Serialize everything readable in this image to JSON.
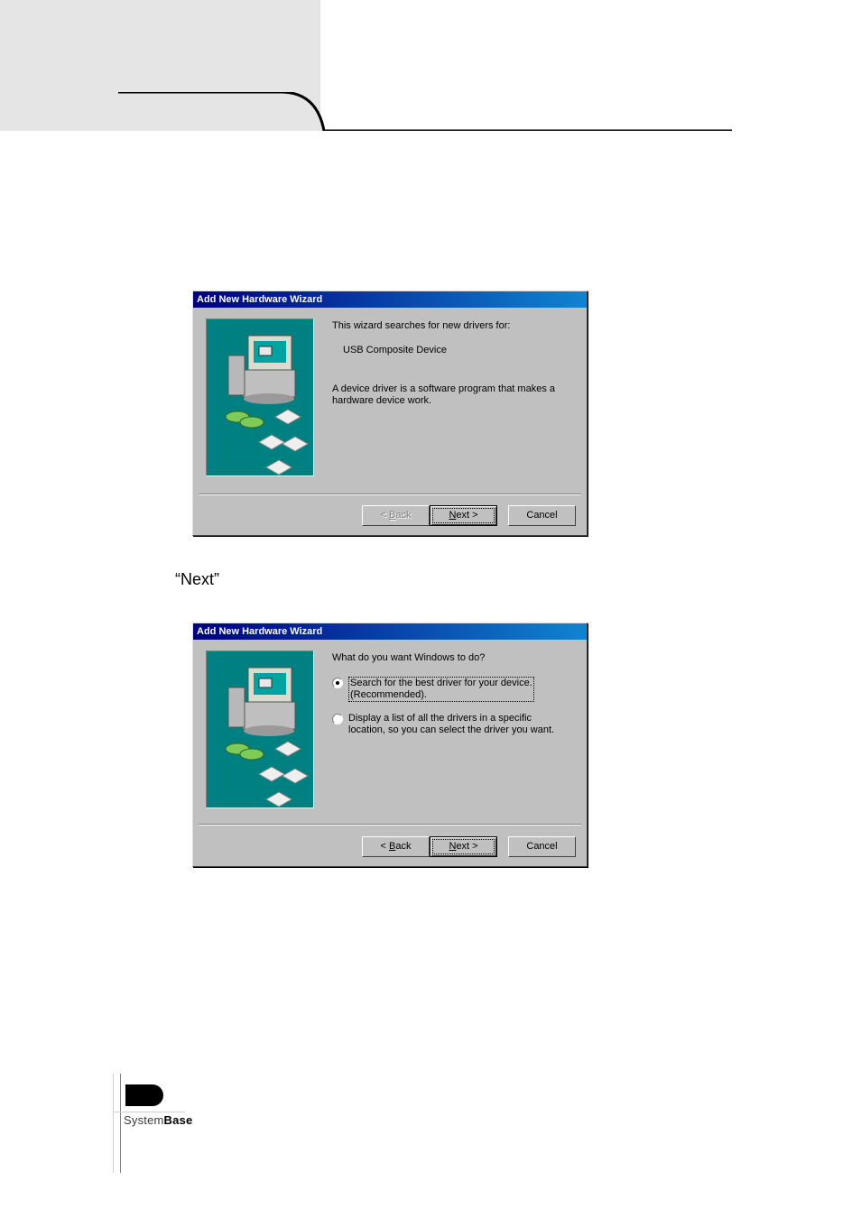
{
  "header": {},
  "caption": {
    "text": "“Next”"
  },
  "dialog1": {
    "title": "Add New Hardware Wizard",
    "line1": "This wizard searches for new drivers for:",
    "device": "USB Composite Device",
    "desc": "A device driver is a software program that makes a hardware device work.",
    "buttons": {
      "back_prefix": "< ",
      "back_ul": "B",
      "back_suffix": "ack",
      "next_prefix": "",
      "next_ul": "N",
      "next_suffix": "ext >",
      "cancel": "Cancel"
    }
  },
  "dialog2": {
    "title": "Add New Hardware Wizard",
    "question": "What do you want Windows to do?",
    "opt1_line1": "Search for the best driver for your device.",
    "opt1_line2": "(Recommended).",
    "opt2_line1": "Display a list of all the drivers in a specific",
    "opt2_line2": "location, so you can select the driver you want.",
    "buttons": {
      "back_prefix": "< ",
      "back_ul": "B",
      "back_suffix": "ack",
      "next_prefix": "",
      "next_ul": "N",
      "next_suffix": "ext >",
      "cancel": "Cancel"
    }
  },
  "footer": {
    "brand_light": "System",
    "brand_bold": "Base"
  }
}
